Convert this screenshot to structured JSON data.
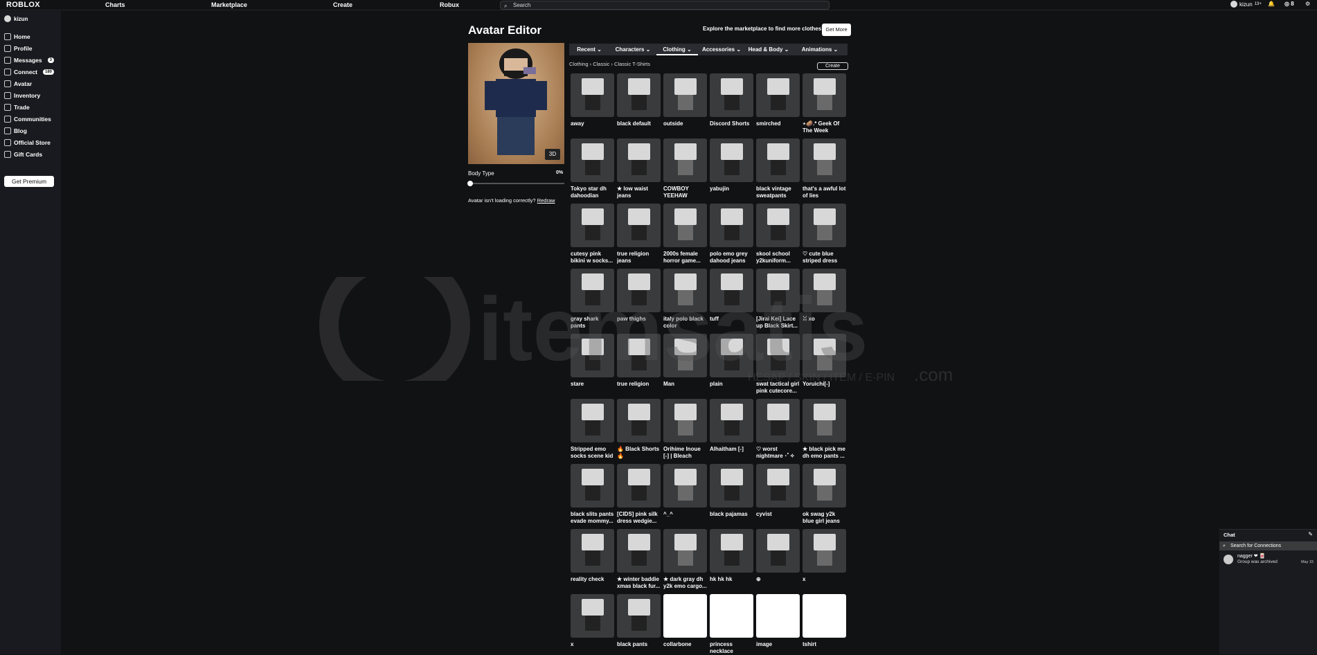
{
  "header": {
    "logo": "ROBLOX",
    "nav": [
      "Charts",
      "Marketplace",
      "Create",
      "Robux"
    ],
    "search_placeholder": "Search",
    "user": "kizun",
    "user_suffix": "13+",
    "robux": "8"
  },
  "sidebar": {
    "user": "kizun",
    "items": [
      {
        "label": "Home",
        "icon": "home-icon"
      },
      {
        "label": "Profile",
        "icon": "profile-icon"
      },
      {
        "label": "Messages",
        "icon": "messages-icon",
        "badge": "3"
      },
      {
        "label": "Connect",
        "icon": "connect-icon",
        "badge": "180"
      },
      {
        "label": "Avatar",
        "icon": "avatar-icon"
      },
      {
        "label": "Inventory",
        "icon": "inventory-icon"
      },
      {
        "label": "Trade",
        "icon": "trade-icon"
      },
      {
        "label": "Communities",
        "icon": "communities-icon"
      },
      {
        "label": "Blog",
        "icon": "blog-icon"
      },
      {
        "label": "Official Store",
        "icon": "store-icon"
      },
      {
        "label": "Gift Cards",
        "icon": "gift-card-icon"
      }
    ],
    "premium": "Get Premium"
  },
  "editor": {
    "title": "Avatar Editor",
    "promo": "Explore the marketplace to find more clothes!",
    "get_more": "Get More",
    "view_3d": "3D",
    "body_type": "Body Type",
    "body_pct": "0%",
    "body_value": 0,
    "load_msg": "Avatar isn't loading correctly?",
    "redraw": "Redraw",
    "tabs": [
      "Recent",
      "Characters",
      "Clothing",
      "Accessories",
      "Head & Body",
      "Animations"
    ],
    "active_tab": "Clothing",
    "breadcrumb": [
      "Clothing",
      "Classic",
      "Classic T-Shirts"
    ],
    "create": "Create"
  },
  "items": [
    "away",
    "black default",
    "outside",
    "Discord Shorts",
    "smirched",
    "⋆🥔.* Geek Of The Week",
    "Tokyo star dh dahoodian pun...",
    "★ low waist jeans",
    "COWBOY YEEHAW TYPE...",
    "yabujin",
    "black vintage sweatpants",
    "that's a awful lot of lies",
    "cutesy pink bikini w socks...",
    "true religion jeans",
    "2000s female horror game...",
    "polo emo grey dahood jeans",
    "skool school y2kuniform...",
    "♡ cute blue striped dress",
    "gray shark pants",
    "paw thighs",
    "italy polo black color",
    "tuff",
    "[Jirai Kei] Lace up Black Skirt...",
    "ꈍ xo",
    "stare",
    "true religion",
    "Man",
    "plain",
    "swat tactical girl pink cutecore...",
    "Yoruichi[-]",
    "Stripped emo socks scene kid",
    "🔥 Black Shorts 🔥",
    "Orihime Inoue [-] | Bleach TYBW",
    "Alhaitham [-]",
    "♡ worst nightmare ･ﾟ✧",
    "★ black pick me dh emo pants ...",
    "black slits pants evade mommy...",
    "[CIDS] pink silk dress wedgie...",
    "^_^",
    "black pajamas",
    "cyvist",
    "ok swag y2k blue girl jeans",
    "reality check",
    "★ winter baddie xmas black fur...",
    "★ dark gray dh y2k emo cargo...",
    "hk hk hk",
    "⊕",
    "x",
    "x",
    "black pants",
    "collarbone",
    "princess necklace",
    "image",
    "tshirt"
  ],
  "chat": {
    "title": "Chat",
    "search": "Search for Connections",
    "conv_name": "nagger ❤ 🀄",
    "conv_msg": "Group was archived",
    "conv_date": "May 15"
  },
  "watermark": {
    "brand": "itemsatis",
    "tagline": "HESAP / SKIN / ITEM / E-PIN",
    "suffix": ".com"
  }
}
